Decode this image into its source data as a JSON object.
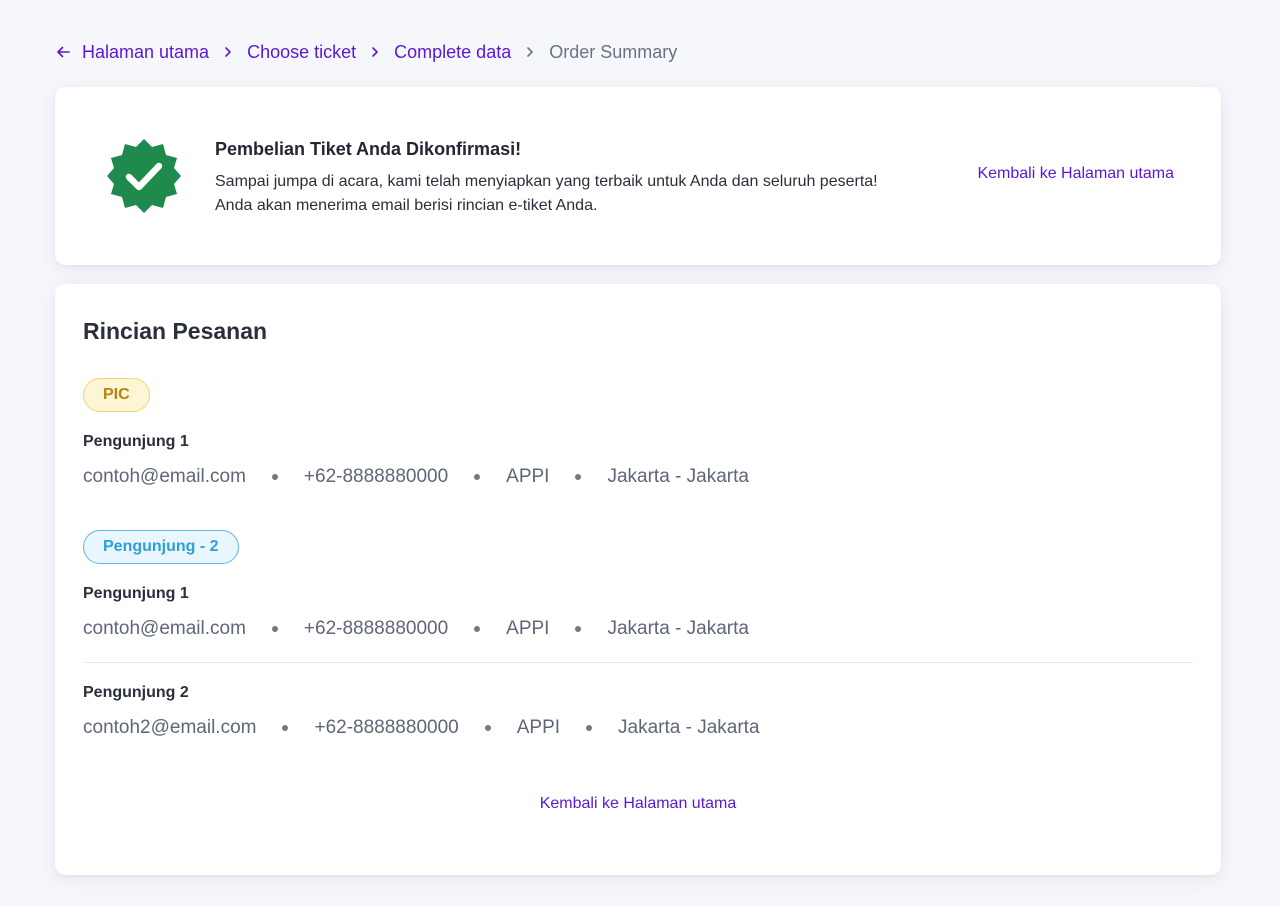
{
  "breadcrumb": {
    "items": [
      "Halaman utama",
      "Choose ticket",
      "Complete data"
    ],
    "current": "Order Summary"
  },
  "confirmation": {
    "icon": "verified-badge-icon",
    "icon_color": "#1f8a4c",
    "title": "Pembelian Tiket Anda Dikonfirmasi!",
    "description": "Sampai jumpa di acara, kami telah menyiapkan yang terbaik untuk Anda dan seluruh peserta! Anda akan menerima email berisi rincian e-tiket Anda.",
    "back_link": "Kembali ke Halaman utama"
  },
  "details": {
    "title": "Rincian Pesanan",
    "groups": [
      {
        "badge": "PIC",
        "visitors": [
          {
            "name": "Pengunjung 1",
            "email": "contoh@email.com",
            "phone": "+62-8888880000",
            "org": "APPI",
            "location": "Jakarta - Jakarta"
          }
        ]
      },
      {
        "badge": "Pengunjung - 2",
        "visitors": [
          {
            "name": "Pengunjung 1",
            "email": "contoh@email.com",
            "phone": "+62-8888880000",
            "org": "APPI",
            "location": "Jakarta - Jakarta"
          },
          {
            "name": "Pengunjung 2",
            "email": "contoh2@email.com",
            "phone": "+62-8888880000",
            "org": "APPI",
            "location": "Jakarta - Jakarta"
          }
        ]
      }
    ],
    "back_link": "Kembali ke Halaman utama"
  },
  "colors": {
    "accent": "#5b17d6",
    "background": "#f6f7fb",
    "pic_badge_bg": "#fef5d4",
    "pic_badge_text": "#b58410",
    "group_badge_bg": "#e9f6fd",
    "group_badge_text": "#2f9fd8"
  }
}
